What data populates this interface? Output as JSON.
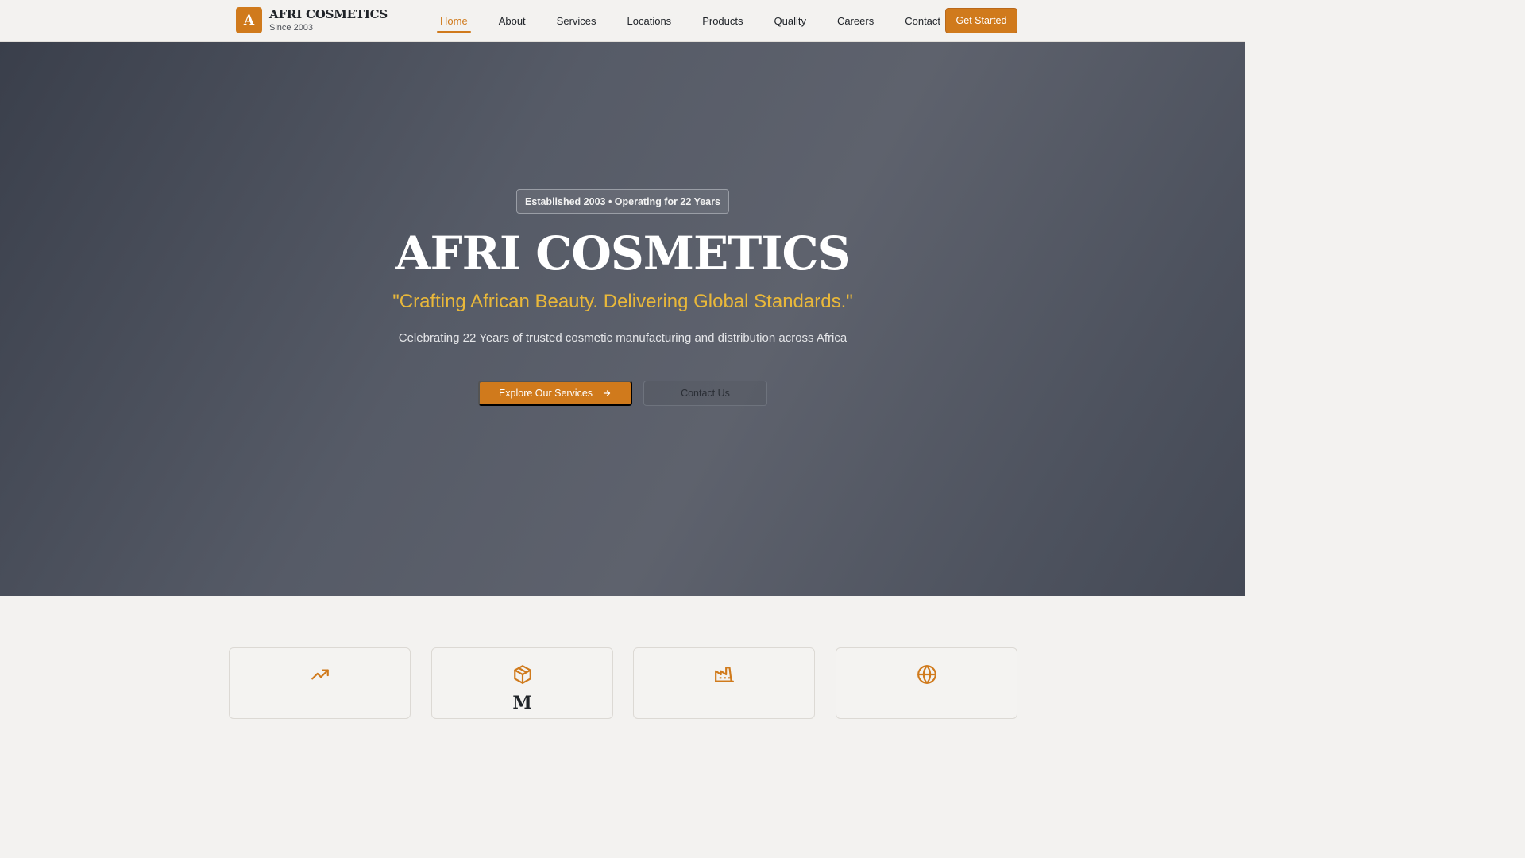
{
  "brand": {
    "mark": "A",
    "name": "AFRI COSMETICS",
    "sub": "Since 2003"
  },
  "nav": {
    "items": [
      {
        "label": "Home",
        "active": true
      },
      {
        "label": "About"
      },
      {
        "label": "Services"
      },
      {
        "label": "Locations"
      },
      {
        "label": "Products"
      },
      {
        "label": "Quality"
      },
      {
        "label": "Careers"
      },
      {
        "label": "Contact"
      }
    ],
    "cta_label": "Get Started"
  },
  "hero": {
    "badge": "Established 2003 • Operating for 22 Years",
    "title": "AFRI COSMETICS",
    "tagline": "\"Crafting African Beauty. Delivering Global Standards.\"",
    "description": "Celebrating 22 Years of trusted cosmetic manufacturing and distribution across Africa",
    "primary_button": "Explore Our Services",
    "secondary_button": "Contact Us"
  },
  "cards": [
    {
      "icon": "trending-up-icon",
      "title": ""
    },
    {
      "icon": "package-icon",
      "title": "M"
    },
    {
      "icon": "factory-icon",
      "title": ""
    },
    {
      "icon": "globe-icon",
      "title": ""
    }
  ],
  "colors": {
    "accent": "#d07a1c",
    "tagline": "#e9b83a",
    "hero_bg": "#565b67"
  }
}
